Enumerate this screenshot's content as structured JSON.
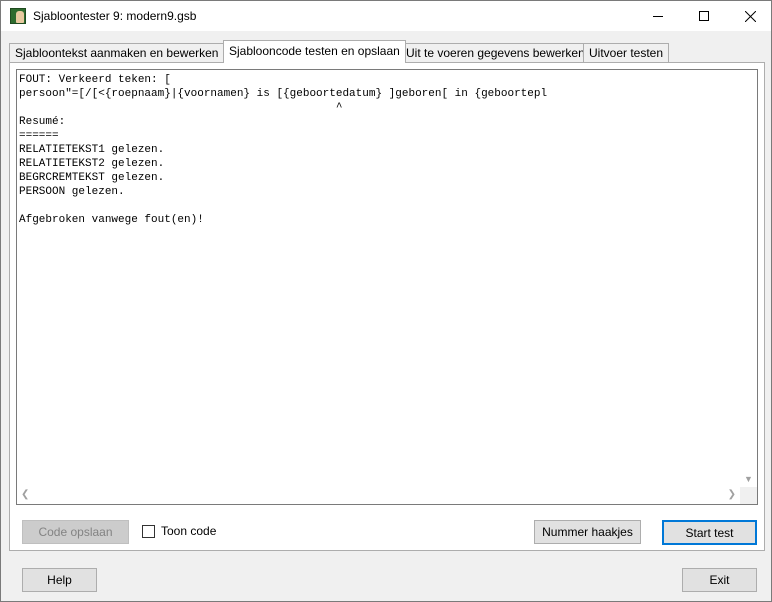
{
  "window": {
    "title": "Sjabloontester 9: modern9.gsb"
  },
  "tabs": [
    {
      "label": "Sjabloontekst aanmaken en bewerken",
      "active": false
    },
    {
      "label": "Sjablooncode testen en opslaan",
      "active": true
    },
    {
      "label": "Uit te voeren gegevens bewerken",
      "active": false
    },
    {
      "label": "Uitvoer testen",
      "active": false
    }
  ],
  "output": {
    "text": "FOUT: Verkeerd teken: [\npersoon\"=[/[<{roepnaam}|{voornamen} is [{geboortedatum} ]geboren[ in {geboortepl\n                                                ^\nResumé:\n======\nRELATIETEKST1 gelezen.\nRELATIETEKST2 gelezen.\nBEGRCREMTEKST gelezen.\nPERSOON gelezen.\n\nAfgebroken vanwege fout(en)!"
  },
  "controls": {
    "code_opslaan_label": "Code opslaan",
    "toon_code_label": "Toon code",
    "toon_code_checked": false,
    "nummer_haakjes_label": "Nummer haakjes",
    "start_test_label": "Start test"
  },
  "footer": {
    "help_label": "Help",
    "exit_label": "Exit"
  },
  "icons": {
    "app": "portrait-icon",
    "minimize": "minimize-icon",
    "maximize": "maximize-icon",
    "close": "close-icon"
  },
  "colors": {
    "accent": "#0078d7",
    "window_bg": "#f0f0f0",
    "button_bg": "#e1e1e1"
  }
}
